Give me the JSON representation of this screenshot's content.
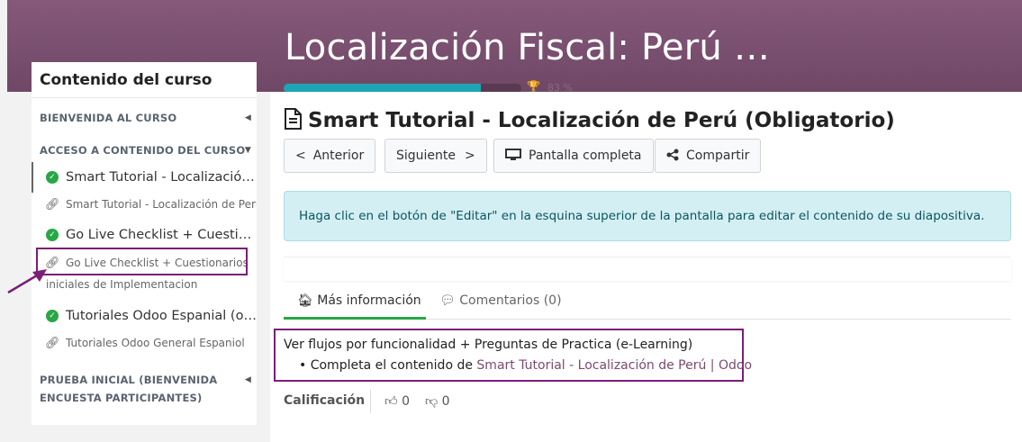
{
  "banner": {
    "course_title": "Localización Fiscal: Perú …",
    "progress_percent": 83,
    "progress_label": "83 %"
  },
  "sidebar": {
    "header": "Contenido del curso",
    "sections": [
      {
        "label": "BIENVENIDA AL CURSO"
      },
      {
        "label": "ACCESO A CONTENIDO DEL CURSO"
      },
      {
        "label_line1": "PRUEBA INICIAL (BIENVENIDA",
        "label_line2": "ENCUESTA PARTICIPANTES)"
      }
    ],
    "items": [
      {
        "label": "Smart Tutorial - Localización …",
        "sub": "Smart Tutorial - Localización de Perú"
      },
      {
        "label": "Go Live Checklist + Cuestiona…",
        "sub_line1": "Go Live Checklist + Cuestionarios",
        "sub_line2": "iniciales de Implementacion"
      },
      {
        "label": "Tutoriales Odoo Espanial (op…",
        "sub": "Tutoriales Odoo General Espaniol"
      }
    ]
  },
  "content": {
    "title": "Smart Tutorial - Localización de Perú (Obligatorio)",
    "buttons": {
      "prev": "Anterior",
      "next": "Siguiente",
      "fullscreen": "Pantalla completa",
      "share": "Compartir"
    },
    "alert": "Haga clic en el botón de \"Editar\" en la esquina superior de la pantalla para editar el contenido de su diapositiva.",
    "tabs": {
      "info": "Más información",
      "comments": "Comentarios (0)"
    },
    "info": {
      "title": "Ver flujos por funcionalidad + Preguntas de Practica (e-Learning)",
      "bullet_prefix": "Completa el contenido de ",
      "bullet_link": "Smart Tutorial - Localización de Perú | Odoo"
    },
    "rating": {
      "label": "Calificación",
      "likes": "0",
      "dislikes": "0"
    }
  },
  "colors": {
    "banner": "#7a5070",
    "progress": "#1fa4b5",
    "highlight": "#7b1e78",
    "success": "#28a745"
  }
}
